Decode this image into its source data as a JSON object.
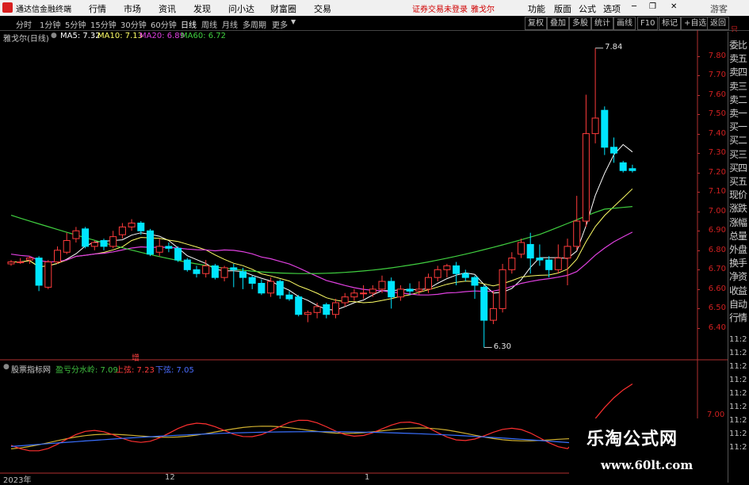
{
  "menubar": {
    "app_title": "通达信金融终端",
    "menus": [
      "行情",
      "市场",
      "资讯",
      "发现",
      "问小达",
      "财富圈",
      "交易"
    ],
    "notice": "证券交易未登录",
    "stock_name": "雅戈尔",
    "right_menus": [
      "功能",
      "版面",
      "公式",
      "选项"
    ],
    "guest": "游客"
  },
  "toolbar": {
    "periods": [
      "分时",
      "1分钟",
      "5分钟",
      "15分钟",
      "30分钟",
      "60分钟",
      "日线",
      "周线",
      "月线",
      "多周期",
      "更多"
    ],
    "active_period": "日线",
    "right_buttons": [
      "复权",
      "叠加",
      "多股",
      "统计",
      "画线",
      "F10",
      "标记",
      "+自选",
      "返回"
    ]
  },
  "legend": {
    "title": "雅戈尔(日线)",
    "ma5": "MA5: 7.32",
    "ma10": "MA10: 7.13",
    "ma20": "MA20: 6.89",
    "ma60": "MA60: 6.72"
  },
  "price_axis": [
    "7.80",
    "7.70",
    "7.60",
    "7.50",
    "7.40",
    "7.30",
    "7.20",
    "7.10",
    "7.00",
    "6.90",
    "6.80",
    "6.70",
    "6.60",
    "6.50",
    "6.40"
  ],
  "price_axis_top": "只",
  "annotations": {
    "high": "7.84",
    "low": "6.30",
    "marker": "增"
  },
  "side_panel": {
    "items": [
      "委比",
      "卖五",
      "卖四",
      "卖三",
      "卖二",
      "卖一",
      "买一",
      "买二",
      "买三",
      "买四",
      "买五",
      "现价",
      "涨跌",
      "涨幅",
      "总量",
      "外盘",
      "换手",
      "净资",
      "收益",
      "自动",
      "行情"
    ],
    "times": [
      "11:2",
      "11:2",
      "11:2",
      "11:2",
      "11:2",
      "11:2",
      "11:2",
      "11:2",
      "11:2"
    ]
  },
  "indicator": {
    "name": "股票指标网",
    "line1": "盈亏分水岭: 7.09",
    "line2": "上弦: 7.23",
    "line3": "下弦: 7.05",
    "axis_label": "7.00"
  },
  "x_axis": [
    "2023年",
    "12",
    "1"
  ],
  "watermark": {
    "title": "乐淘公式网",
    "url": "www.60lt.com"
  },
  "colors": {
    "up": "#ff3b3b",
    "down": "#00e5ff",
    "ma5": "#ffffff",
    "ma10": "#ffff66",
    "ma20": "#e040e0",
    "ma60": "#40d040"
  },
  "candles": [
    [
      6.73,
      6.74,
      6.72,
      6.75
    ],
    [
      6.74,
      6.74,
      6.73,
      6.76
    ],
    [
      6.75,
      6.76,
      6.73,
      6.77
    ],
    [
      6.76,
      6.62,
      6.59,
      6.77
    ],
    [
      6.61,
      6.74,
      6.6,
      6.75
    ],
    [
      6.74,
      6.8,
      6.73,
      6.82
    ],
    [
      6.79,
      6.85,
      6.78,
      6.89
    ],
    [
      6.86,
      6.9,
      6.84,
      6.92
    ],
    [
      6.91,
      6.82,
      6.81,
      6.92
    ],
    [
      6.82,
      6.84,
      6.8,
      6.85
    ],
    [
      6.85,
      6.82,
      6.8,
      6.86
    ],
    [
      6.82,
      6.87,
      6.81,
      6.9
    ],
    [
      6.88,
      6.92,
      6.86,
      6.94
    ],
    [
      6.92,
      6.94,
      6.9,
      6.96
    ],
    [
      6.94,
      6.9,
      6.88,
      6.95
    ],
    [
      6.9,
      6.78,
      6.77,
      6.91
    ],
    [
      6.79,
      6.82,
      6.77,
      6.86
    ],
    [
      6.82,
      6.81,
      6.79,
      6.84
    ],
    [
      6.81,
      6.75,
      6.74,
      6.82
    ],
    [
      6.75,
      6.7,
      6.69,
      6.76
    ],
    [
      6.7,
      6.68,
      6.66,
      6.72
    ],
    [
      6.68,
      6.72,
      6.66,
      6.75
    ],
    [
      6.72,
      6.66,
      6.65,
      6.73
    ],
    [
      6.66,
      6.71,
      6.64,
      6.72
    ],
    [
      6.71,
      6.7,
      6.61,
      6.73
    ],
    [
      6.69,
      6.66,
      6.6,
      6.71
    ],
    [
      6.66,
      6.63,
      6.6,
      6.67
    ],
    [
      6.63,
      6.58,
      6.57,
      6.65
    ],
    [
      6.58,
      6.64,
      6.56,
      6.66
    ],
    [
      6.64,
      6.57,
      6.55,
      6.65
    ],
    [
      6.57,
      6.55,
      6.54,
      6.59
    ],
    [
      6.56,
      6.47,
      6.46,
      6.57
    ],
    [
      6.47,
      6.48,
      6.43,
      6.49
    ],
    [
      6.48,
      6.51,
      6.45,
      6.53
    ],
    [
      6.52,
      6.47,
      6.45,
      6.53
    ],
    [
      6.47,
      6.53,
      6.45,
      6.55
    ],
    [
      6.53,
      6.56,
      6.51,
      6.58
    ],
    [
      6.56,
      6.58,
      6.54,
      6.6
    ],
    [
      6.58,
      6.58,
      6.55,
      6.62
    ],
    [
      6.58,
      6.6,
      6.56,
      6.62
    ],
    [
      6.6,
      6.64,
      6.58,
      6.67
    ],
    [
      6.64,
      6.56,
      6.5,
      6.66
    ],
    [
      6.56,
      6.6,
      6.54,
      6.62
    ],
    [
      6.6,
      6.59,
      6.57,
      6.63
    ],
    [
      6.59,
      6.6,
      6.57,
      6.64
    ],
    [
      6.6,
      6.66,
      6.58,
      6.68
    ],
    [
      6.66,
      6.7,
      6.64,
      6.72
    ],
    [
      6.7,
      6.72,
      6.66,
      6.73
    ],
    [
      6.72,
      6.68,
      6.62,
      6.74
    ],
    [
      6.68,
      6.66,
      6.64,
      6.7
    ],
    [
      6.66,
      6.62,
      6.55,
      6.67
    ],
    [
      6.61,
      6.44,
      6.3,
      6.62
    ],
    [
      6.44,
      6.5,
      6.42,
      6.59
    ],
    [
      6.5,
      6.7,
      6.48,
      6.73
    ],
    [
      6.7,
      6.76,
      6.68,
      6.79
    ],
    [
      6.78,
      6.84,
      6.76,
      6.86
    ],
    [
      6.83,
      6.76,
      6.68,
      6.89
    ],
    [
      6.76,
      6.75,
      6.72,
      6.83
    ],
    [
      6.75,
      6.7,
      6.66,
      6.77
    ],
    [
      6.7,
      6.76,
      6.68,
      6.83
    ],
    [
      6.76,
      6.82,
      6.62,
      6.86
    ],
    [
      6.82,
      6.95,
      6.8,
      7.08
    ],
    [
      6.95,
      7.4,
      6.92,
      7.6
    ],
    [
      7.4,
      7.48,
      7.35,
      7.84
    ],
    [
      7.52,
      7.33,
      7.29,
      7.54
    ],
    [
      7.33,
      7.3,
      7.25,
      7.38
    ],
    [
      7.25,
      7.21,
      7.2,
      7.26
    ],
    [
      7.22,
      7.21,
      7.2,
      7.24
    ]
  ]
}
